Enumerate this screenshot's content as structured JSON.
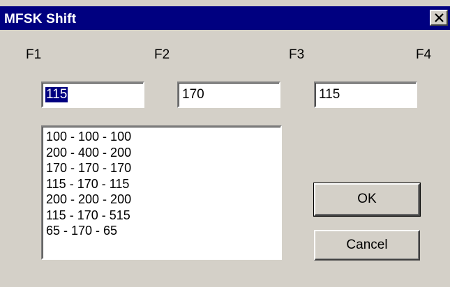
{
  "window": {
    "title": "MFSK Shift",
    "close_icon": "close-icon",
    "colors": {
      "titlebar": "#000080",
      "face": "#d4d0c8",
      "selection": "#000080"
    }
  },
  "labels": {
    "f1": "F1",
    "f2": "F2",
    "f3": "F3",
    "f4": "F4"
  },
  "fields": {
    "f1_value": "115",
    "f2_value": "170",
    "f3_value": "115"
  },
  "presets": [
    "100 - 100 - 100",
    "200 - 400 - 200",
    "170 - 170 - 170",
    "115 - 170 - 115",
    "200 - 200 - 200",
    "115 - 170 - 515",
    "65 - 170 - 65"
  ],
  "buttons": {
    "ok_label": "OK",
    "cancel_label": "Cancel"
  }
}
